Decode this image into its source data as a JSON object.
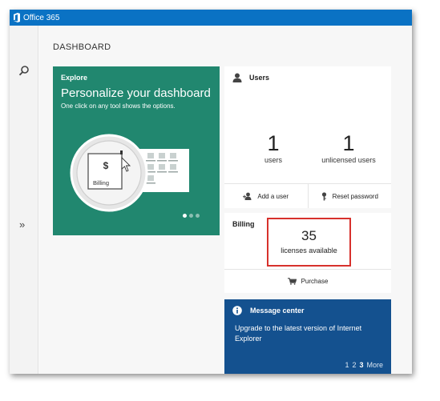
{
  "app": {
    "title": "Office 365"
  },
  "page": {
    "title": "DASHBOARD"
  },
  "explore": {
    "label": "Explore",
    "headline": "Personalize your dashboard",
    "subtitle": "One click on any tool shows the options.",
    "illustration_label": "Billing",
    "illustration_symbol": "$",
    "pages": 3,
    "active_page": 1
  },
  "users": {
    "title": "Users",
    "users_count": "1",
    "users_caption": "users",
    "unlicensed_count": "1",
    "unlicensed_caption": "unlicensed users",
    "add_user_label": "Add a user",
    "reset_password_label": "Reset password"
  },
  "billing": {
    "title": "Billing",
    "licenses_count": "35",
    "licenses_caption": "licenses available",
    "purchase_label": "Purchase"
  },
  "message_center": {
    "title": "Message center",
    "message": "Upgrade to the latest version of Internet Explorer",
    "pages": [
      "1",
      "2",
      "3"
    ],
    "current_page": "3",
    "more_label": "More"
  },
  "nav": {
    "expand_glyph": "»"
  },
  "colors": {
    "topbar": "#0a72c4",
    "explore": "#21876f",
    "message_center": "#14518f",
    "highlight": "#d7312c"
  }
}
